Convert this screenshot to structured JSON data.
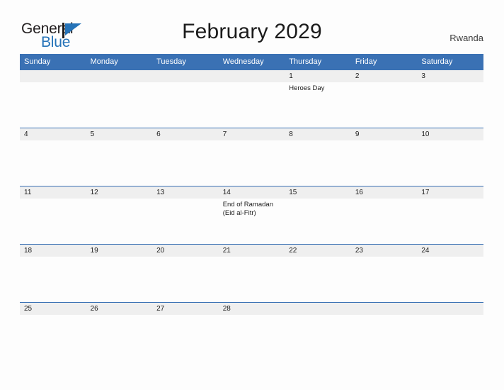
{
  "brand": {
    "name_part1": "General",
    "name_part2": "Blue",
    "flag_icon": "blue-flag-triangle",
    "accent_color": "#2573b8"
  },
  "header": {
    "title": "February 2029",
    "country": "Rwanda"
  },
  "colors": {
    "header_blue": "#3a71b4",
    "daynum_band": "#efefef",
    "page_background": "#fdfdfd",
    "text": "#1b1b1b"
  },
  "calendar": {
    "month": "February",
    "year": "2029",
    "weekday_headers": [
      "Sunday",
      "Monday",
      "Tuesday",
      "Wednesday",
      "Thursday",
      "Friday",
      "Saturday"
    ],
    "weeks": [
      [
        {
          "day": "",
          "events": []
        },
        {
          "day": "",
          "events": []
        },
        {
          "day": "",
          "events": []
        },
        {
          "day": "",
          "events": []
        },
        {
          "day": "1",
          "events": [
            "Heroes Day"
          ]
        },
        {
          "day": "2",
          "events": []
        },
        {
          "day": "3",
          "events": []
        }
      ],
      [
        {
          "day": "4",
          "events": []
        },
        {
          "day": "5",
          "events": []
        },
        {
          "day": "6",
          "events": []
        },
        {
          "day": "7",
          "events": []
        },
        {
          "day": "8",
          "events": []
        },
        {
          "day": "9",
          "events": []
        },
        {
          "day": "10",
          "events": []
        }
      ],
      [
        {
          "day": "11",
          "events": []
        },
        {
          "day": "12",
          "events": []
        },
        {
          "day": "13",
          "events": []
        },
        {
          "day": "14",
          "events": [
            "End of Ramadan",
            "(Eid al-Fitr)"
          ]
        },
        {
          "day": "15",
          "events": []
        },
        {
          "day": "16",
          "events": []
        },
        {
          "day": "17",
          "events": []
        }
      ],
      [
        {
          "day": "18",
          "events": []
        },
        {
          "day": "19",
          "events": []
        },
        {
          "day": "20",
          "events": []
        },
        {
          "day": "21",
          "events": []
        },
        {
          "day": "22",
          "events": []
        },
        {
          "day": "23",
          "events": []
        },
        {
          "day": "24",
          "events": []
        }
      ],
      [
        {
          "day": "25",
          "events": []
        },
        {
          "day": "26",
          "events": []
        },
        {
          "day": "27",
          "events": []
        },
        {
          "day": "28",
          "events": []
        },
        {
          "day": "",
          "events": []
        },
        {
          "day": "",
          "events": []
        },
        {
          "day": "",
          "events": []
        }
      ]
    ]
  }
}
